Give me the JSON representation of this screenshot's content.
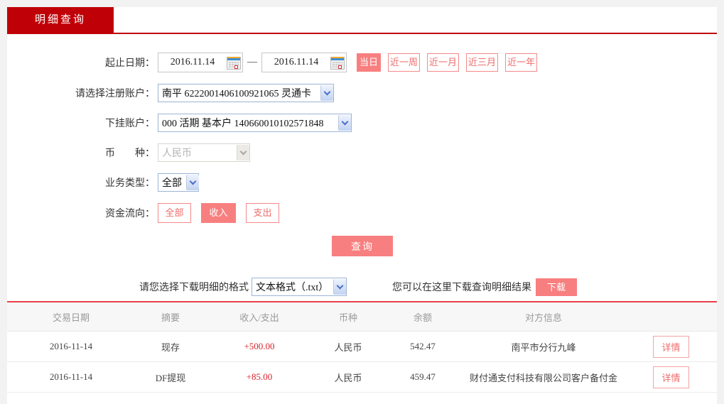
{
  "tab": {
    "label": "明细查询"
  },
  "form": {
    "date_label": "起止日期：",
    "date_from": "2016.11.14",
    "date_to": "2016.11.14",
    "date_separator": "—",
    "range_buttons": {
      "today": "当日",
      "week": "近一周",
      "month": "近一月",
      "quarter": "近三月",
      "year": "近一年"
    },
    "register_account": {
      "label": "请选择注册账户：",
      "value": "南平 6222001406100921065 灵通卡"
    },
    "sub_account": {
      "label": "下挂账户：",
      "value": "000 活期 基本户 140660010102571848"
    },
    "currency": {
      "label": "币　　种：",
      "value": "人民币"
    },
    "business_type": {
      "label": "业务类型：",
      "value": "全部"
    },
    "fund_flow": {
      "label": "资金流向：",
      "options": [
        "全部",
        "收入",
        "支出"
      ],
      "active": "收入"
    },
    "query_button": "查询"
  },
  "download": {
    "format_label": "请您选择下载明细的格式",
    "format_value": "文本格式（.txt）",
    "hint": "您可以在这里下载查询明细结果",
    "button": "下载"
  },
  "table": {
    "headers": [
      "交易日期",
      "摘要",
      "收入/支出",
      "币种",
      "余额",
      "对方信息"
    ],
    "detail_button": "详情",
    "rows": [
      {
        "date": "2016-11-14",
        "summary": "现存",
        "amount": "+500.00",
        "currency": "人民币",
        "balance": "542.47",
        "counterparty": "南平市分行九峰"
      },
      {
        "date": "2016-11-14",
        "summary": "DF提现",
        "amount": "+85.00",
        "currency": "人民币",
        "balance": "459.47",
        "counterparty": "财付通支付科技有限公司客户备付金"
      }
    ]
  },
  "colors": {
    "brand_red": "#c00007",
    "accent_salmon": "#f87f7f",
    "amount_red": "#d9232e",
    "table_top_line": "#e8404a"
  }
}
